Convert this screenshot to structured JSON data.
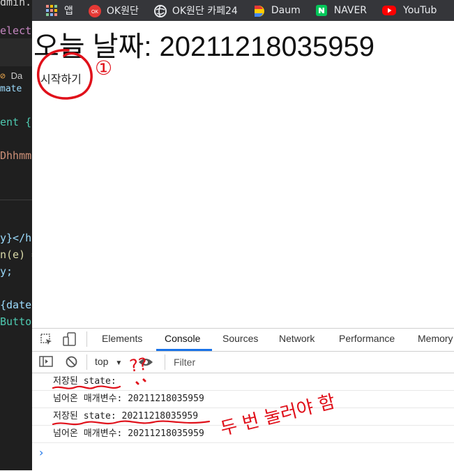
{
  "editor": {
    "lines": [
      {
        "text": "dmin.c",
        "color": "#d4d4d4"
      },
      {
        "text": "elect",
        "color": "#c586c0"
      },
      {
        "text": "Da",
        "color": "#cccccc"
      },
      {
        "text": "mate",
        "color": "#9cdcfe"
      },
      {
        "text": "ent {",
        "color": "#4ec9b0"
      },
      {
        "text": "Dhhmms",
        "color": "#ce9178"
      },
      {
        "text": "y}</h",
        "color": "#9cdcfe"
      },
      {
        "text": "n(e) =",
        "color": "#dcdcaa"
      },
      {
        "text": "y;",
        "color": "#9cdcfe"
      },
      {
        "text": "{date}",
        "color": "#9cdcfe"
      },
      {
        "text": "Butto",
        "color": "#4ec9b0"
      }
    ]
  },
  "bookmarks": [
    {
      "label": "앱",
      "icon": "apps-grid-icon"
    },
    {
      "label": "OK원단",
      "icon": "ok-logo-icon",
      "color": "#e53935"
    },
    {
      "label": "OK원단 카페24",
      "icon": "globe-icon",
      "color": "#e8eaed"
    },
    {
      "label": "Daum",
      "icon": "daum-logo-icon",
      "color": "#6a5acd"
    },
    {
      "label": "NAVER",
      "icon": "naver-logo-icon",
      "color": "#03c75a"
    },
    {
      "label": "YouTub",
      "icon": "youtube-logo-icon",
      "color": "#ff0000"
    }
  ],
  "page": {
    "title": "오늘 날짜: 20211218035959",
    "start_button": "시작하기"
  },
  "devtools": {
    "tabs": [
      "Elements",
      "Console",
      "Sources",
      "Network",
      "Performance",
      "Memory"
    ],
    "active_tab": "Console",
    "context": "top",
    "filter_placeholder": "Filter",
    "logs": [
      "저장된 state:",
      "넘어온 매개변수: 20211218035959",
      "저장된 state: 20211218035959",
      "넘어온 매개변수: 20211218035959"
    ],
    "prompt": "›"
  },
  "annotations": {
    "marker_1": "①",
    "question": "??",
    "note": "두 번 눌러야 함",
    "color": "#e0101a"
  }
}
